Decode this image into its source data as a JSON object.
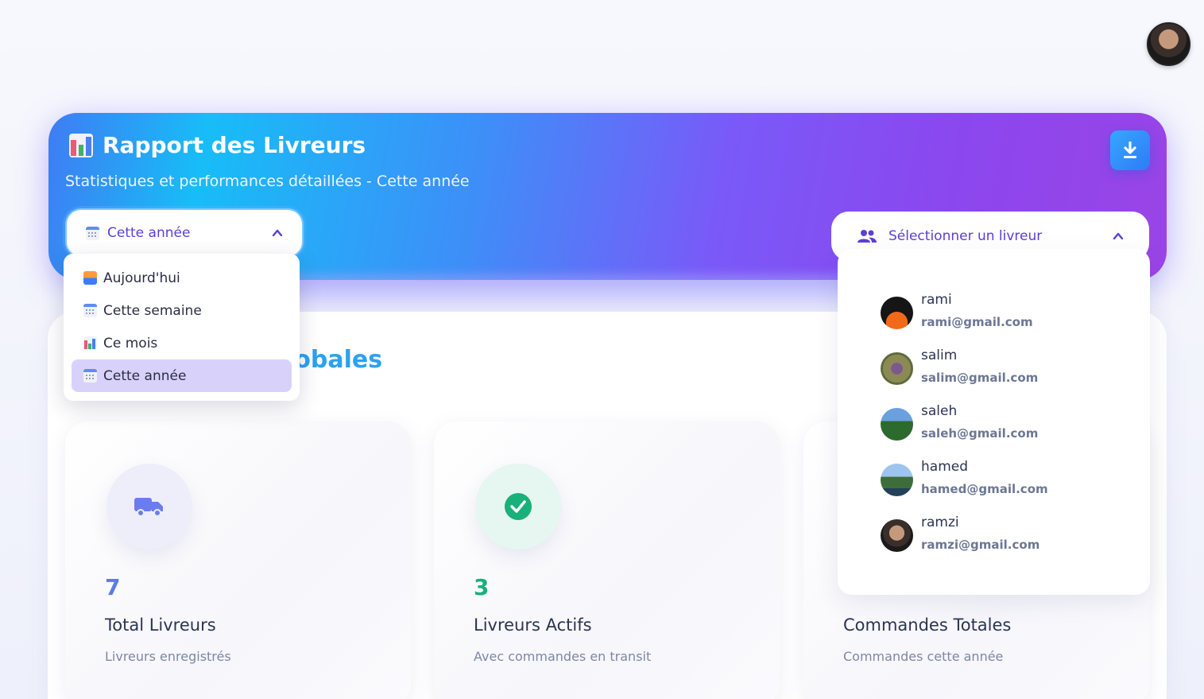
{
  "header": {
    "title": "Rapport des Livreurs",
    "subtitle": "Statistiques et performances détaillées - Cette année"
  },
  "period_select": {
    "selected": "Cette année",
    "options": [
      {
        "label": "Aujourd'hui",
        "icon": "sunrise-icon"
      },
      {
        "label": "Cette semaine",
        "icon": "calendar-icon"
      },
      {
        "label": "Ce mois",
        "icon": "bar-chart-icon"
      },
      {
        "label": "Cette année",
        "icon": "calendar-icon"
      }
    ]
  },
  "driver_select": {
    "placeholder": "Sélectionner un livreur",
    "drivers": [
      {
        "name": "rami",
        "email": "rami@gmail.com"
      },
      {
        "name": "salim",
        "email": "salim@gmail.com"
      },
      {
        "name": "saleh",
        "email": "saleh@gmail.com"
      },
      {
        "name": "hamed",
        "email": "hamed@gmail.com"
      },
      {
        "name": "ramzi",
        "email": "ramzi@gmail.com"
      }
    ]
  },
  "section": {
    "title_visible": "lobales"
  },
  "stats": [
    {
      "value": "7",
      "label": "Total Livreurs",
      "desc": "Livreurs enregistrés",
      "icon": "truck-icon",
      "color": "#5b7bea"
    },
    {
      "value": "3",
      "label": "Livreurs Actifs",
      "desc": "Avec commandes en transit",
      "icon": "check-circle-icon",
      "color": "#19b07a"
    },
    {
      "value": "",
      "label": "Commandes Totales",
      "desc": "Commandes cette année",
      "icon": "",
      "color": "#5b7bea"
    }
  ],
  "colors": {
    "accent": "#5b3fd6",
    "header_gradient_start": "#17bdf7",
    "header_gradient_end": "#9a44e6",
    "selected_item_bg": "#d8d2fb"
  }
}
